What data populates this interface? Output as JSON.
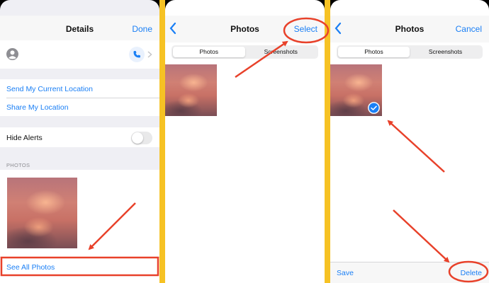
{
  "details": {
    "title": "Details",
    "done_label": "Done",
    "send_location_label": "Send My Current Location",
    "share_location_label": "Share My Location",
    "hide_alerts_label": "Hide Alerts",
    "photos_section_label": "PHOTOS",
    "see_all_label": "See All Photos"
  },
  "photos_view": {
    "title": "Photos",
    "select_label": "Select",
    "tabs": [
      {
        "label": "Photos"
      },
      {
        "label": "Screenshots"
      }
    ]
  },
  "photos_select": {
    "title": "Photos",
    "cancel_label": "Cancel",
    "tabs": [
      {
        "label": "Photos"
      },
      {
        "label": "Screenshots"
      }
    ],
    "save_label": "Save",
    "delete_label": "Delete"
  },
  "colors": {
    "accent": "#1a7ff5",
    "annotation": "#e8412a",
    "separator": "#f6c224"
  }
}
